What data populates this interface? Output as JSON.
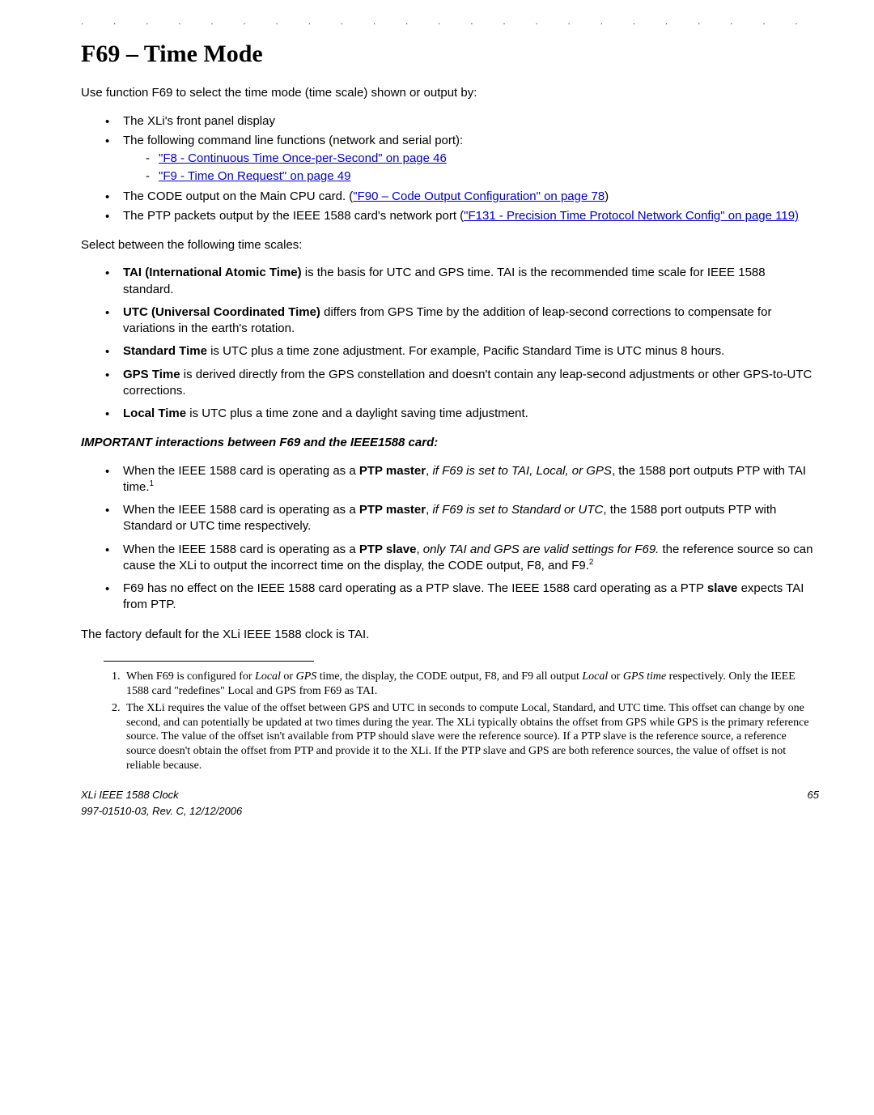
{
  "dots": ". . . . . . . . . . . . . . . . . . . . . . . . . . . . . . . . . . . . . . . . . . . .",
  "title": "F69 – Time Mode",
  "intro": "Use function F69 to select the time mode (time scale) shown or output by:",
  "bullets1": {
    "b1": "The XLi's front panel display",
    "b2": "The following command line functions (network and serial port):",
    "b2a": "\"F8 - Continuous Time Once-per-Second\" on page 46",
    "b2b": "\"F9 - Time On Request\" on page 49",
    "b3_pre": "The CODE output on the Main CPU card. (",
    "b3_link": "\"F90 – Code Output Configuration\" on page 78",
    "b3_post": ")",
    "b4_pre": "The PTP packets output by the IEEE 1588 card's network port (",
    "b4_link": "\"F131 - Precision Time Protocol Network Config\" on page 119)"
  },
  "select_intro": "Select between the following time scales:",
  "scales": {
    "s1_bold": "TAI (International Atomic Time)",
    "s1_rest": " is the basis for UTC and GPS time. TAI is the recommended time scale for IEEE 1588 standard.",
    "s2_bold": "UTC (Universal Coordinated Time)",
    "s2_rest": " differs from GPS Time by the addition of leap-second corrections to compensate for variations in the earth's rotation.",
    "s3_bold": "Standard Time",
    "s3_rest": " is UTC plus a time zone adjustment. For example, Pacific Standard Time is UTC minus 8 hours.",
    "s4_bold": "GPS Time",
    "s4_rest": " is derived directly from the GPS constellation and doesn't contain any leap-second adjustments or other GPS-to-UTC corrections.",
    "s5_bold": "Local Time",
    "s5_rest": " is UTC plus a time zone and a daylight saving time adjustment."
  },
  "subheading": "IMPORTANT interactions between F69 and the IEEE1588 card:",
  "interactions": {
    "i1_a": "When the IEEE 1588 card is operating as a ",
    "i1_b": "PTP master",
    "i1_c": ", ",
    "i1_d": "if F69 is set to TAI, Local, or GPS",
    "i1_e": ", the 1588 port outputs PTP with TAI time.",
    "i1_sup": "1",
    "i2_a": "When the IEEE 1588 card is operating as a ",
    "i2_b": "PTP master",
    "i2_c": ", ",
    "i2_d": "if F69 is set to Standard or UTC",
    "i2_e": ", the 1588 port outputs PTP with Standard or UTC time respectively.",
    "i3_a": "When the IEEE 1588 card is operating as a ",
    "i3_b": "PTP slave",
    "i3_c": ", ",
    "i3_d": "only TAI and GPS are valid settings for F69.",
    "i3_e": " the reference source so can cause the XLi to output the incorrect time on the display, the CODE output, F8, and F9.",
    "i3_sup": "2",
    "i4": "F69 has no effect on the IEEE 1588 card operating as a PTP slave. The IEEE 1588 card operating as a PTP ",
    "i4_b": "slave",
    "i4_c": " expects TAI from PTP."
  },
  "factory": "The factory default for the XLi IEEE 1588 clock is TAI.",
  "footnotes": {
    "f1_num": "1.",
    "f1_a": "When F69 is configured for ",
    "f1_b": "Local",
    "f1_c": " or ",
    "f1_d": "GPS",
    "f1_e": " time, the display, the CODE output, F8, and F9 all output ",
    "f1_f": "Local",
    "f1_g": " or ",
    "f1_h": "GPS time",
    "f1_i": " respectively. Only the IEEE 1588 card \"redefines\" Local and GPS from F69 as TAI.",
    "f2_num": "2.",
    "f2": "The XLi requires the value of the offset between GPS and UTC in seconds to compute Local, Standard, and UTC time. This offset can change by one second, and can potentially be updated at two times during the year. The XLi typically obtains the offset from GPS while GPS is the primary reference source. The value of the offset isn't available from PTP should slave were the reference source). If a PTP slave is the reference source, a reference source doesn't obtain the offset from PTP and provide it to the XLi. If the PTP slave and GPS are both reference sources, the value of offset is not reliable because."
  },
  "footer": {
    "left1": "XLi IEEE 1588 Clock",
    "right": "65",
    "left2": "997-01510-03, Rev. C, 12/12/2006"
  }
}
